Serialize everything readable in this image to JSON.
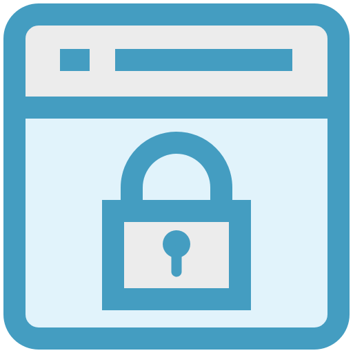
{
  "icon": {
    "subject": "secure-browser-window-icon",
    "parts": [
      "browser-window-icon",
      "padlock-icon",
      "keyhole-icon"
    ]
  },
  "colors": {
    "stroke": "#449dc1",
    "title_bar_fill": "#ececec",
    "body_fill": "#e1f3fb",
    "lock_body_fill": "#ececec",
    "background": "#ffffff"
  },
  "state": {
    "lock": "locked"
  }
}
